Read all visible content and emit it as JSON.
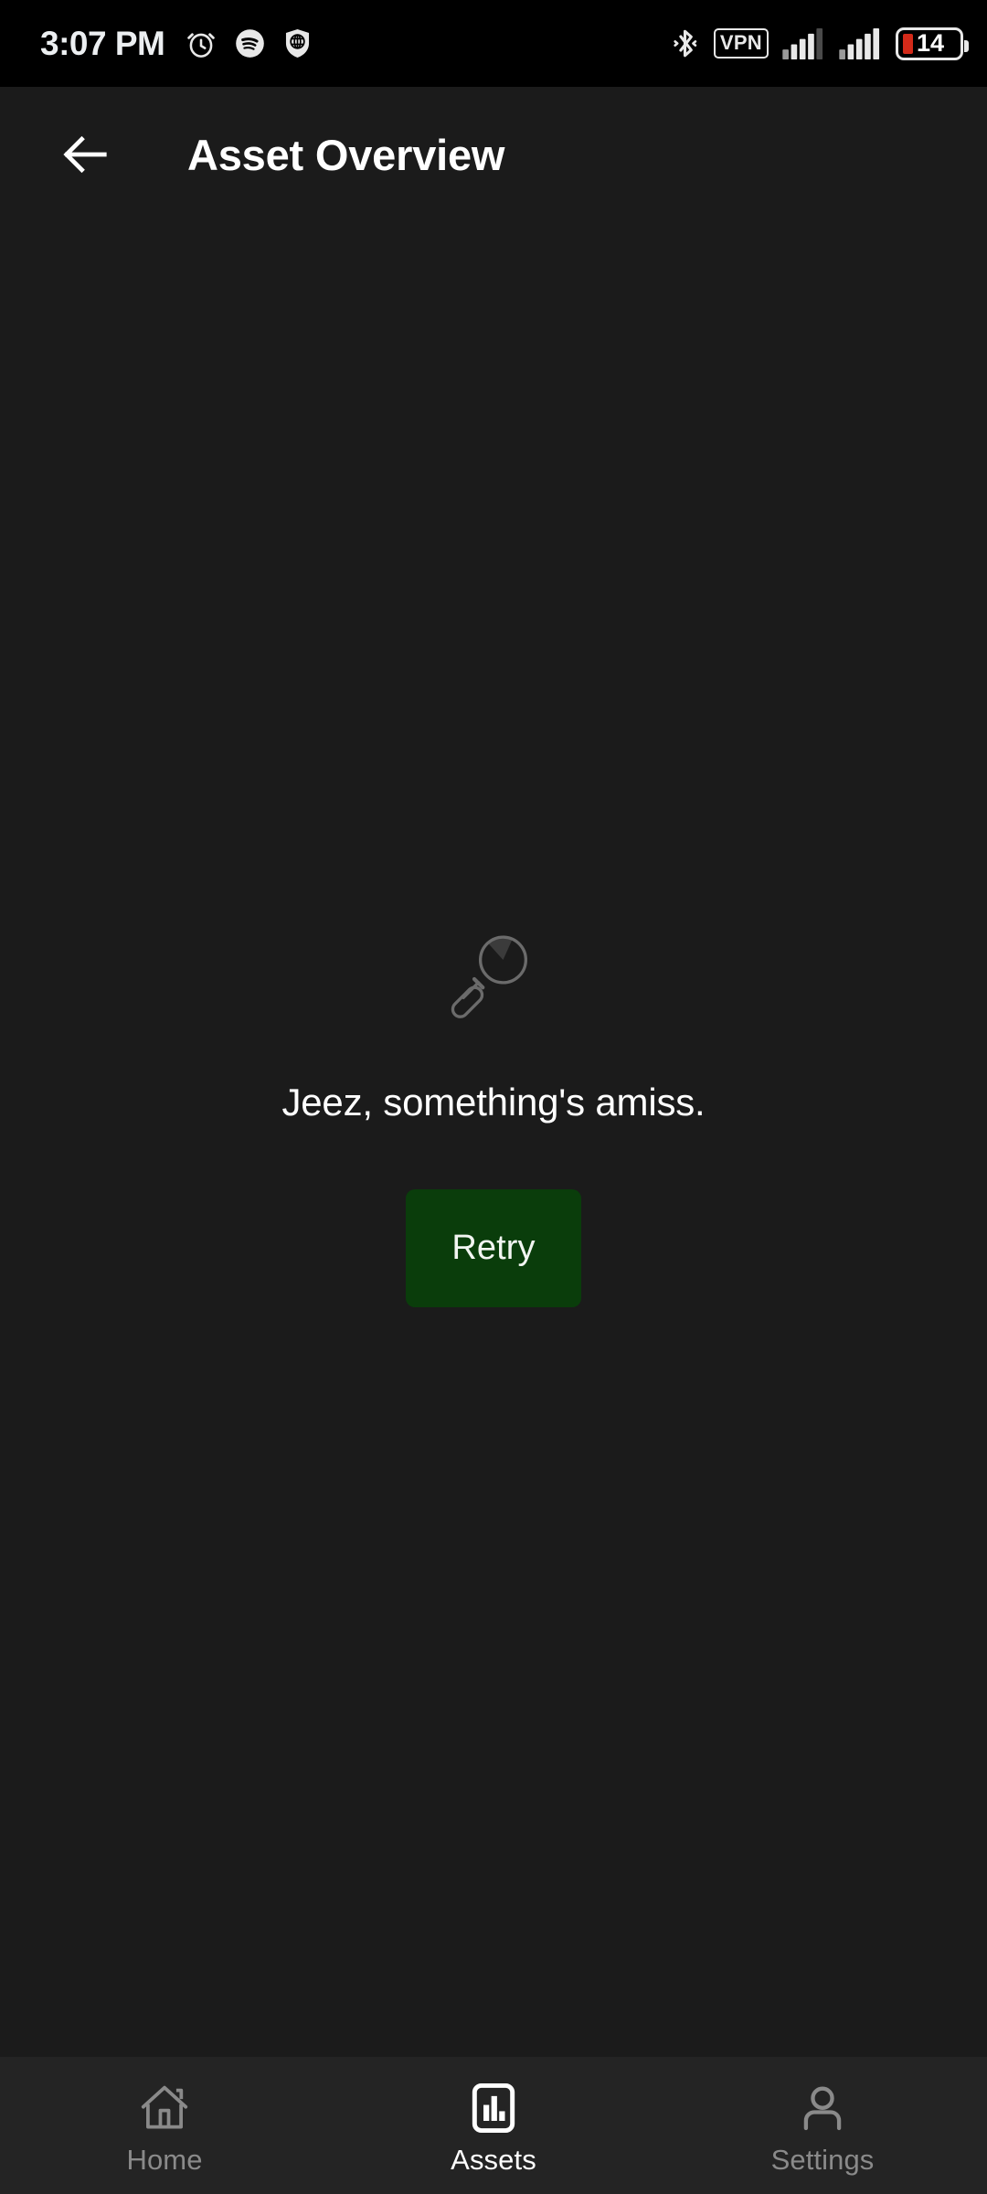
{
  "status_bar": {
    "time": "3:07 PM",
    "left_icons": [
      "alarm-clock-icon",
      "spotify-icon",
      "shield-globe-icon"
    ],
    "right_icons": [
      "bluetooth-icon",
      "vpn-badge",
      "signal-bars-sim1-icon",
      "signal-bars-sim2-icon",
      "battery-icon"
    ],
    "vpn_label": "VPN",
    "battery_level": "14",
    "battery_fill_color": "#d32a19",
    "background_color": "#000000"
  },
  "header": {
    "back_icon": "arrow-left-icon",
    "title": "Asset Overview",
    "background_color": "#1b1b1b"
  },
  "main": {
    "background_color": "#1b1b1b",
    "empty_state": {
      "icon": "magnifying-glass-icon",
      "icon_color": "#6b6b6b",
      "message": "Jeez, something's amiss.",
      "message_color": "#ffffff",
      "retry_label": "Retry",
      "retry_bg_color": "#0a3d0b",
      "retry_text_color": "#f2f6f2"
    }
  },
  "bottom_nav": {
    "background_color": "#242424",
    "active_color": "#ffffff",
    "inactive_color": "#8a8a8a",
    "items": [
      {
        "label": "Home",
        "icon": "home-icon",
        "active": false
      },
      {
        "label": "Assets",
        "icon": "bar-chart-icon",
        "active": true
      },
      {
        "label": "Settings",
        "icon": "person-icon",
        "active": false
      }
    ]
  }
}
